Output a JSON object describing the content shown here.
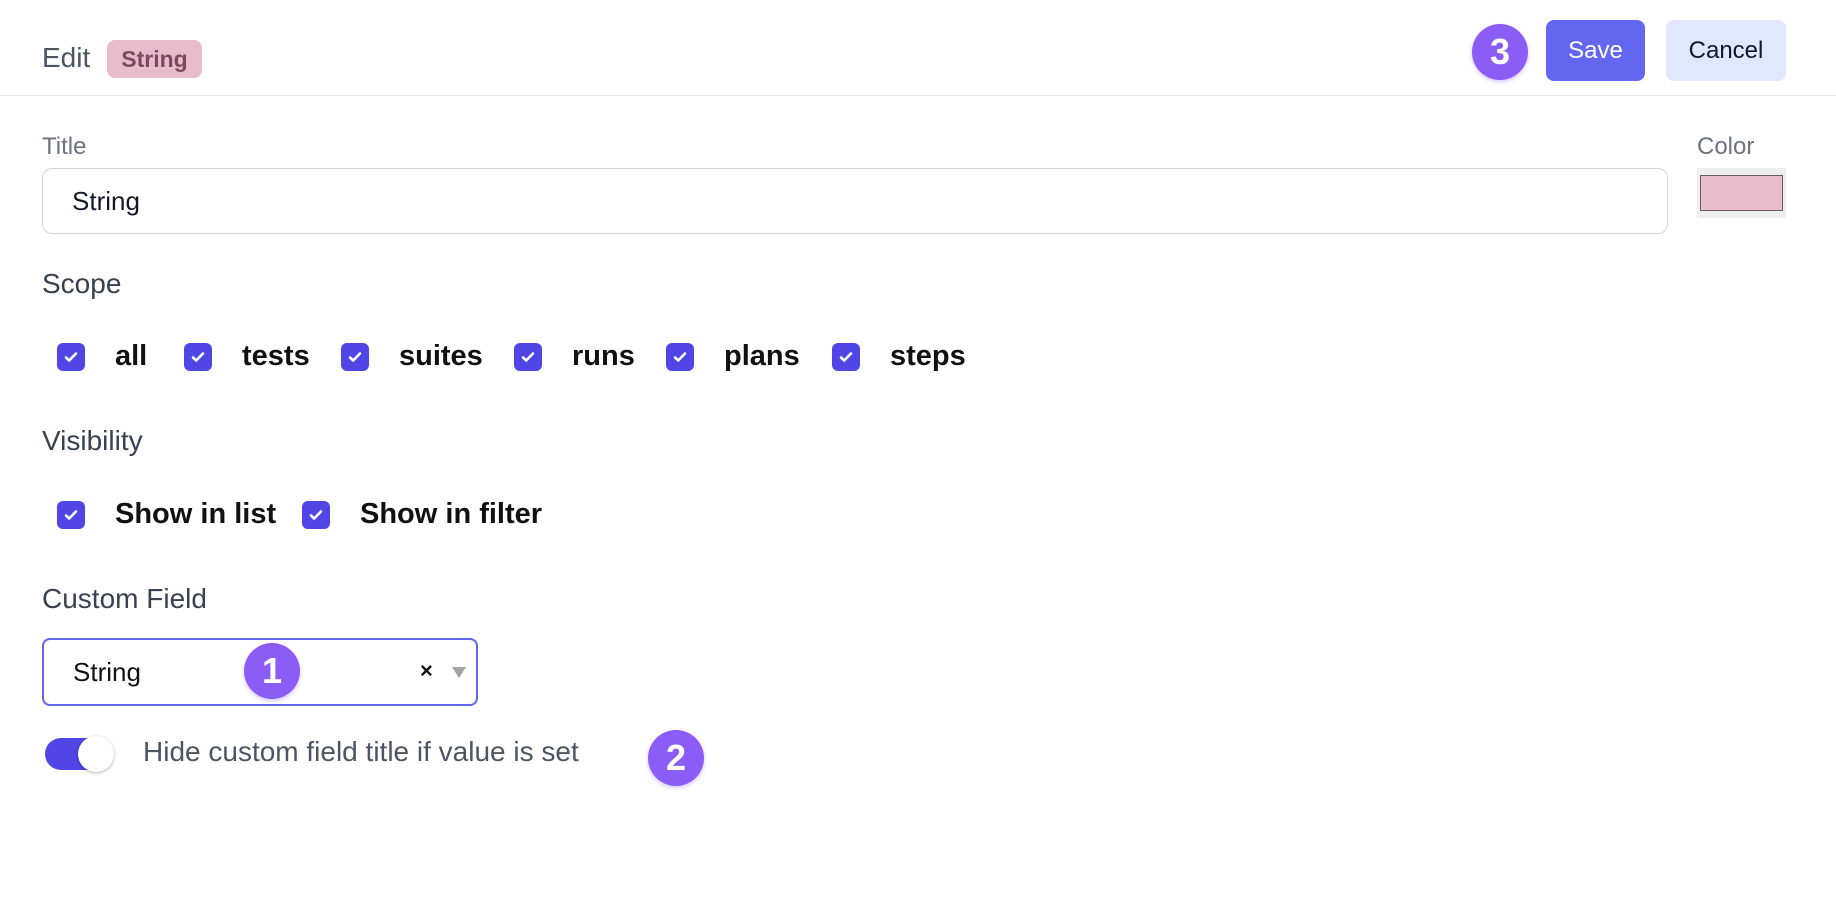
{
  "header": {
    "edit_label": "Edit",
    "type_badge": "String",
    "save_label": "Save",
    "cancel_label": "Cancel",
    "step_badge": "3"
  },
  "title_field": {
    "label": "Title",
    "value": "String"
  },
  "color_field": {
    "label": "Color",
    "value": "#e8bccb"
  },
  "scope": {
    "label": "Scope",
    "options": [
      {
        "label": "all",
        "checked": true
      },
      {
        "label": "tests",
        "checked": true
      },
      {
        "label": "suites",
        "checked": true
      },
      {
        "label": "runs",
        "checked": true
      },
      {
        "label": "plans",
        "checked": true
      },
      {
        "label": "steps",
        "checked": true
      }
    ]
  },
  "visibility": {
    "label": "Visibility",
    "options": [
      {
        "label": "Show in list",
        "checked": true
      },
      {
        "label": "Show in filter",
        "checked": true
      }
    ]
  },
  "custom_field": {
    "label": "Custom Field",
    "selected": "String",
    "clear_glyph": "×",
    "step_badge": "1"
  },
  "hide_title_toggle": {
    "label": "Hide custom field title if value is set",
    "on": true,
    "step_badge": "2"
  },
  "colors": {
    "accent": "#4f46e5",
    "save_button": "#6366f1",
    "cancel_button": "#e0e7ff",
    "step_badge": "#8b5cf6",
    "type_badge_bg": "#e8bccb"
  }
}
